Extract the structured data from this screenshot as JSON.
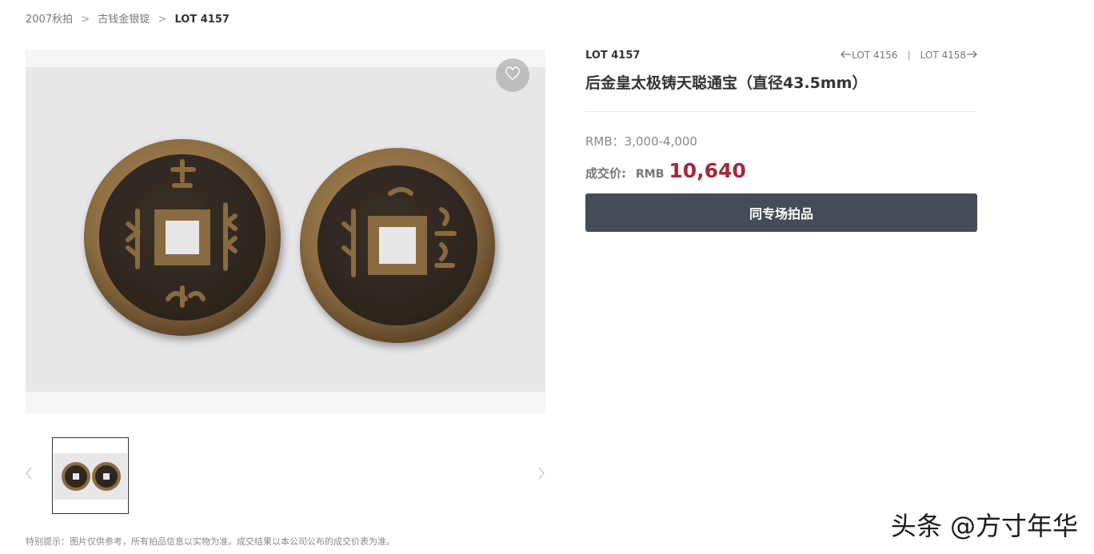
{
  "breadcrumb": {
    "items": [
      {
        "label": "2007秋拍"
      },
      {
        "label": "古钱金银锭"
      }
    ],
    "separator": ">",
    "current": "LOT 4157"
  },
  "lot": {
    "number": "LOT 4157",
    "title": "后金皇太极铸天聪通宝（直径43.5mm）",
    "prev_label": "LOT 4156",
    "next_label": "LOT 4158",
    "nav_separator": "|",
    "estimate": "RMB：3,000-4,000",
    "deal_label": "成交价:",
    "deal_currency": "RMB",
    "deal_price": "10,640",
    "session_button": "同专场拍品"
  },
  "gallery": {
    "icons": {
      "favorite": "heart-icon",
      "prev": "chevron-left-icon",
      "next": "chevron-right-icon"
    },
    "thumbnail_count": 1,
    "selected_thumbnail": 1
  },
  "disclaimer": "特别提示：图片仅供参考，所有拍品信息以实物为准。成交结果以本公司公布的成交价表为准。",
  "watermark": "头条 @方寸年华",
  "colors": {
    "accent_price": "#a3283b",
    "button_bg": "#454c57",
    "photo_bg": "#e7e7e9"
  }
}
